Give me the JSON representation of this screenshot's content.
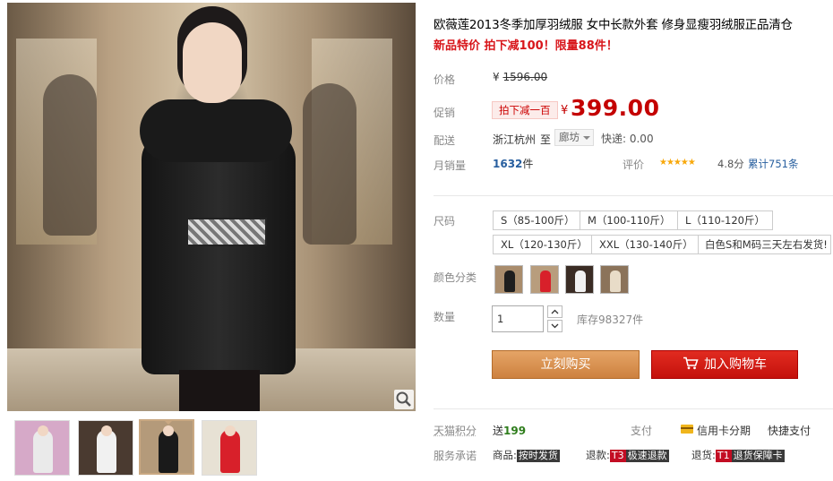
{
  "gallery": {
    "zoom_icon": "magnifier-icon",
    "thumbnails": [
      {
        "name": "white-fur-collar",
        "coat_color": "#eaeaea",
        "bg": "#d6a9c8"
      },
      {
        "name": "white-coat",
        "coat_color": "#f1f1f1",
        "bg": "#4a3a30"
      },
      {
        "name": "black-coat",
        "coat_color": "#1a1a1a",
        "bg": "#b49a7a"
      },
      {
        "name": "red-coat",
        "coat_color": "#d8202a",
        "bg": "#e7e1d4"
      }
    ]
  },
  "product": {
    "title": "欧薇莲2013冬季加厚羽绒服 女中长款外套 修身显瘦羽绒服正品清仓",
    "promo_line": "新品特价 拍下减100！限量88件！"
  },
  "price": {
    "label": "价格",
    "currency": "¥",
    "original": "1596.00"
  },
  "promotion": {
    "label": "促销",
    "tag": "拍下减一百",
    "currency": "¥",
    "price": "399.00"
  },
  "shipping": {
    "label": "配送",
    "from": "浙江杭州",
    "to": "至",
    "city": "廊坊",
    "fee": "快递: 0.00"
  },
  "sales": {
    "label": "月销量",
    "count": "1632",
    "unit": "件"
  },
  "rating": {
    "label": "评价",
    "stars": "★★★★★",
    "score": "4.8分",
    "reviews": "累计751条",
    "star_color": "#f8a80b"
  },
  "size": {
    "label": "尺码",
    "options": [
      "S（85-100斤）",
      "M（100-110斤）",
      "L（110-120斤）",
      "XL（120-130斤）",
      "XXL（130-140斤）",
      "白色S和M码三天左右发货!"
    ]
  },
  "color": {
    "label": "颜色分类",
    "swatches": [
      {
        "name": "black-coat",
        "coat_color": "#1e1e1e",
        "bg": "#a98c6c"
      },
      {
        "name": "red-coat",
        "coat_color": "#d8202a",
        "bg": "#b89d7d"
      },
      {
        "name": "white-coat",
        "coat_color": "#f1f1f1",
        "bg": "#3a2c24"
      },
      {
        "name": "beige-coat",
        "coat_color": "#e8dcc8",
        "bg": "#8b735a"
      }
    ]
  },
  "quantity": {
    "label": "数量",
    "value": "1",
    "stock": "库存98327件"
  },
  "actions": {
    "buy_now": "立刻购买",
    "add_to_cart": "加入购物车",
    "buy_color": "#cd813f",
    "cart_color": "#c4110c"
  },
  "points": {
    "label": "天猫积分",
    "prefix": "送",
    "value": "199"
  },
  "payment": {
    "label": "支付",
    "credit": "信用卡分期",
    "quick": "快捷支付"
  },
  "promise": {
    "label": "服务承诺",
    "items": [
      {
        "prefix": "商品:",
        "tag": "按时发货"
      },
      {
        "prefix": "退款:",
        "tag": "T3",
        "text": "极速退款"
      },
      {
        "prefix": "退货:",
        "tag": "T1",
        "text": "退货保障卡"
      }
    ]
  }
}
